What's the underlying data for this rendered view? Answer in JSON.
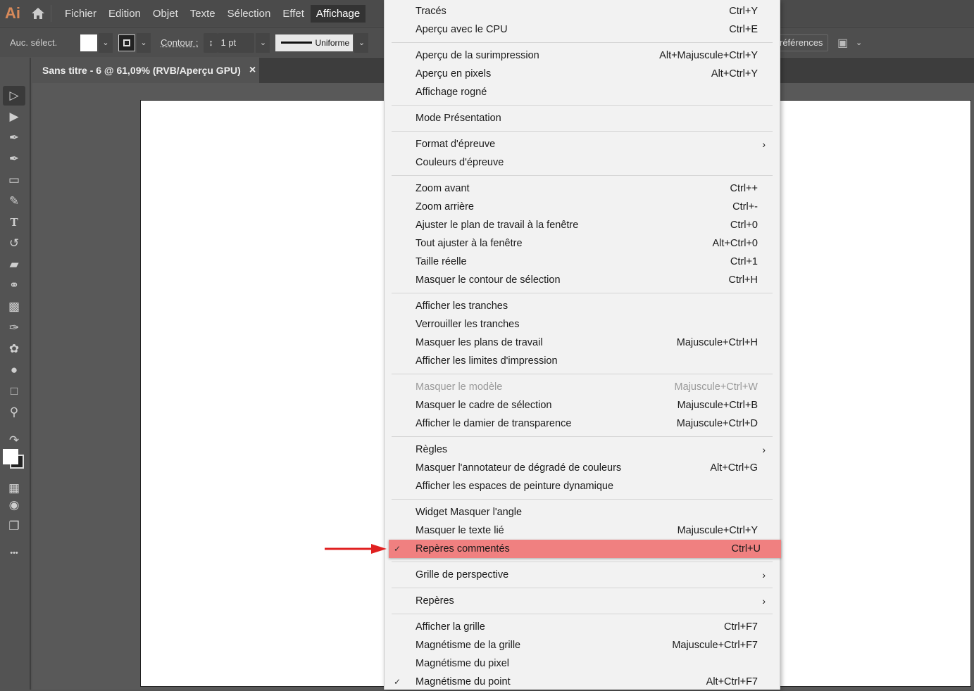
{
  "app": {
    "logo": "Ai",
    "menus": [
      "Fichier",
      "Edition",
      "Objet",
      "Texte",
      "Sélection",
      "Effet",
      "Affichage"
    ],
    "active_menu": "Affichage"
  },
  "control": {
    "selection": "Auc. sélect.",
    "stroke_label": "Contour :",
    "stroke_value": "1 pt",
    "profile": "Uniforme",
    "prefs": "références"
  },
  "document": {
    "tab_title": "Sans titre - 6 @ 61,09% (RVB/Aperçu GPU)",
    "close": "×"
  },
  "tools": [
    "selection-tool",
    "direct-selection-tool",
    "pen-tool",
    "curvature-tool",
    "rectangle-tool",
    "paintbrush-tool",
    "type-tool",
    "rotate-tool",
    "eraser-tool",
    "shape-builder-tool",
    "gradient-tool",
    "eyedropper-tool",
    "puppet-warp-tool",
    "blend-tool",
    "artboard-tool",
    "zoom-tool"
  ],
  "colors": {
    "highlight": "#f08080",
    "arrow": "#e02020",
    "logo": "#d88a5a"
  },
  "view_menu": [
    [
      {
        "label": "Tracés",
        "shortcut": "Ctrl+Y"
      },
      {
        "label": "Aperçu avec le CPU",
        "shortcut": "Ctrl+E"
      }
    ],
    [
      {
        "label": "Aperçu de la surimpression",
        "shortcut": "Alt+Majuscule+Ctrl+Y"
      },
      {
        "label": "Aperçu en pixels",
        "shortcut": "Alt+Ctrl+Y"
      },
      {
        "label": "Affichage rogné",
        "shortcut": ""
      }
    ],
    [
      {
        "label": "Mode Présentation",
        "shortcut": ""
      }
    ],
    [
      {
        "label": "Format d'épreuve",
        "shortcut": "",
        "submenu": true
      },
      {
        "label": "Couleurs d'épreuve",
        "shortcut": ""
      }
    ],
    [
      {
        "label": "Zoom avant",
        "shortcut": "Ctrl++"
      },
      {
        "label": "Zoom arrière",
        "shortcut": "Ctrl+-"
      },
      {
        "label": "Ajuster le plan de travail à la fenêtre",
        "shortcut": "Ctrl+0"
      },
      {
        "label": "Tout ajuster à la fenêtre",
        "shortcut": "Alt+Ctrl+0"
      },
      {
        "label": "Taille réelle",
        "shortcut": "Ctrl+1"
      },
      {
        "label": "Masquer le contour de sélection",
        "shortcut": "Ctrl+H"
      }
    ],
    [
      {
        "label": "Afficher les tranches",
        "shortcut": ""
      },
      {
        "label": "Verrouiller les tranches",
        "shortcut": ""
      },
      {
        "label": "Masquer les plans de travail",
        "shortcut": "Majuscule+Ctrl+H"
      },
      {
        "label": "Afficher les limites d'impression",
        "shortcut": ""
      }
    ],
    [
      {
        "label": "Masquer le modèle",
        "shortcut": "Majuscule+Ctrl+W",
        "disabled": true
      },
      {
        "label": "Masquer le cadre de sélection",
        "shortcut": "Majuscule+Ctrl+B"
      },
      {
        "label": "Afficher le damier de transparence",
        "shortcut": "Majuscule+Ctrl+D"
      }
    ],
    [
      {
        "label": "Règles",
        "shortcut": "",
        "submenu": true
      },
      {
        "label": "Masquer l'annotateur de dégradé de couleurs",
        "shortcut": "Alt+Ctrl+G"
      },
      {
        "label": "Afficher les espaces de peinture dynamique",
        "shortcut": ""
      }
    ],
    [
      {
        "label": "Widget Masquer l'angle",
        "shortcut": ""
      },
      {
        "label": "Masquer le texte lié",
        "shortcut": "Majuscule+Ctrl+Y"
      },
      {
        "label": "Repères commentés",
        "shortcut": "Ctrl+U",
        "checked": true,
        "highlighted": true
      }
    ],
    [
      {
        "label": "Grille de perspective",
        "shortcut": "",
        "submenu": true
      }
    ],
    [
      {
        "label": "Repères",
        "shortcut": "",
        "submenu": true
      }
    ],
    [
      {
        "label": "Afficher la grille",
        "shortcut": "Ctrl+F7"
      },
      {
        "label": "Magnétisme de la grille",
        "shortcut": "Majuscule+Ctrl+F7"
      },
      {
        "label": "Magnétisme du pixel",
        "shortcut": ""
      },
      {
        "label": "Magnétisme du point",
        "shortcut": "Alt+Ctrl+F7",
        "checked": true
      }
    ]
  ]
}
